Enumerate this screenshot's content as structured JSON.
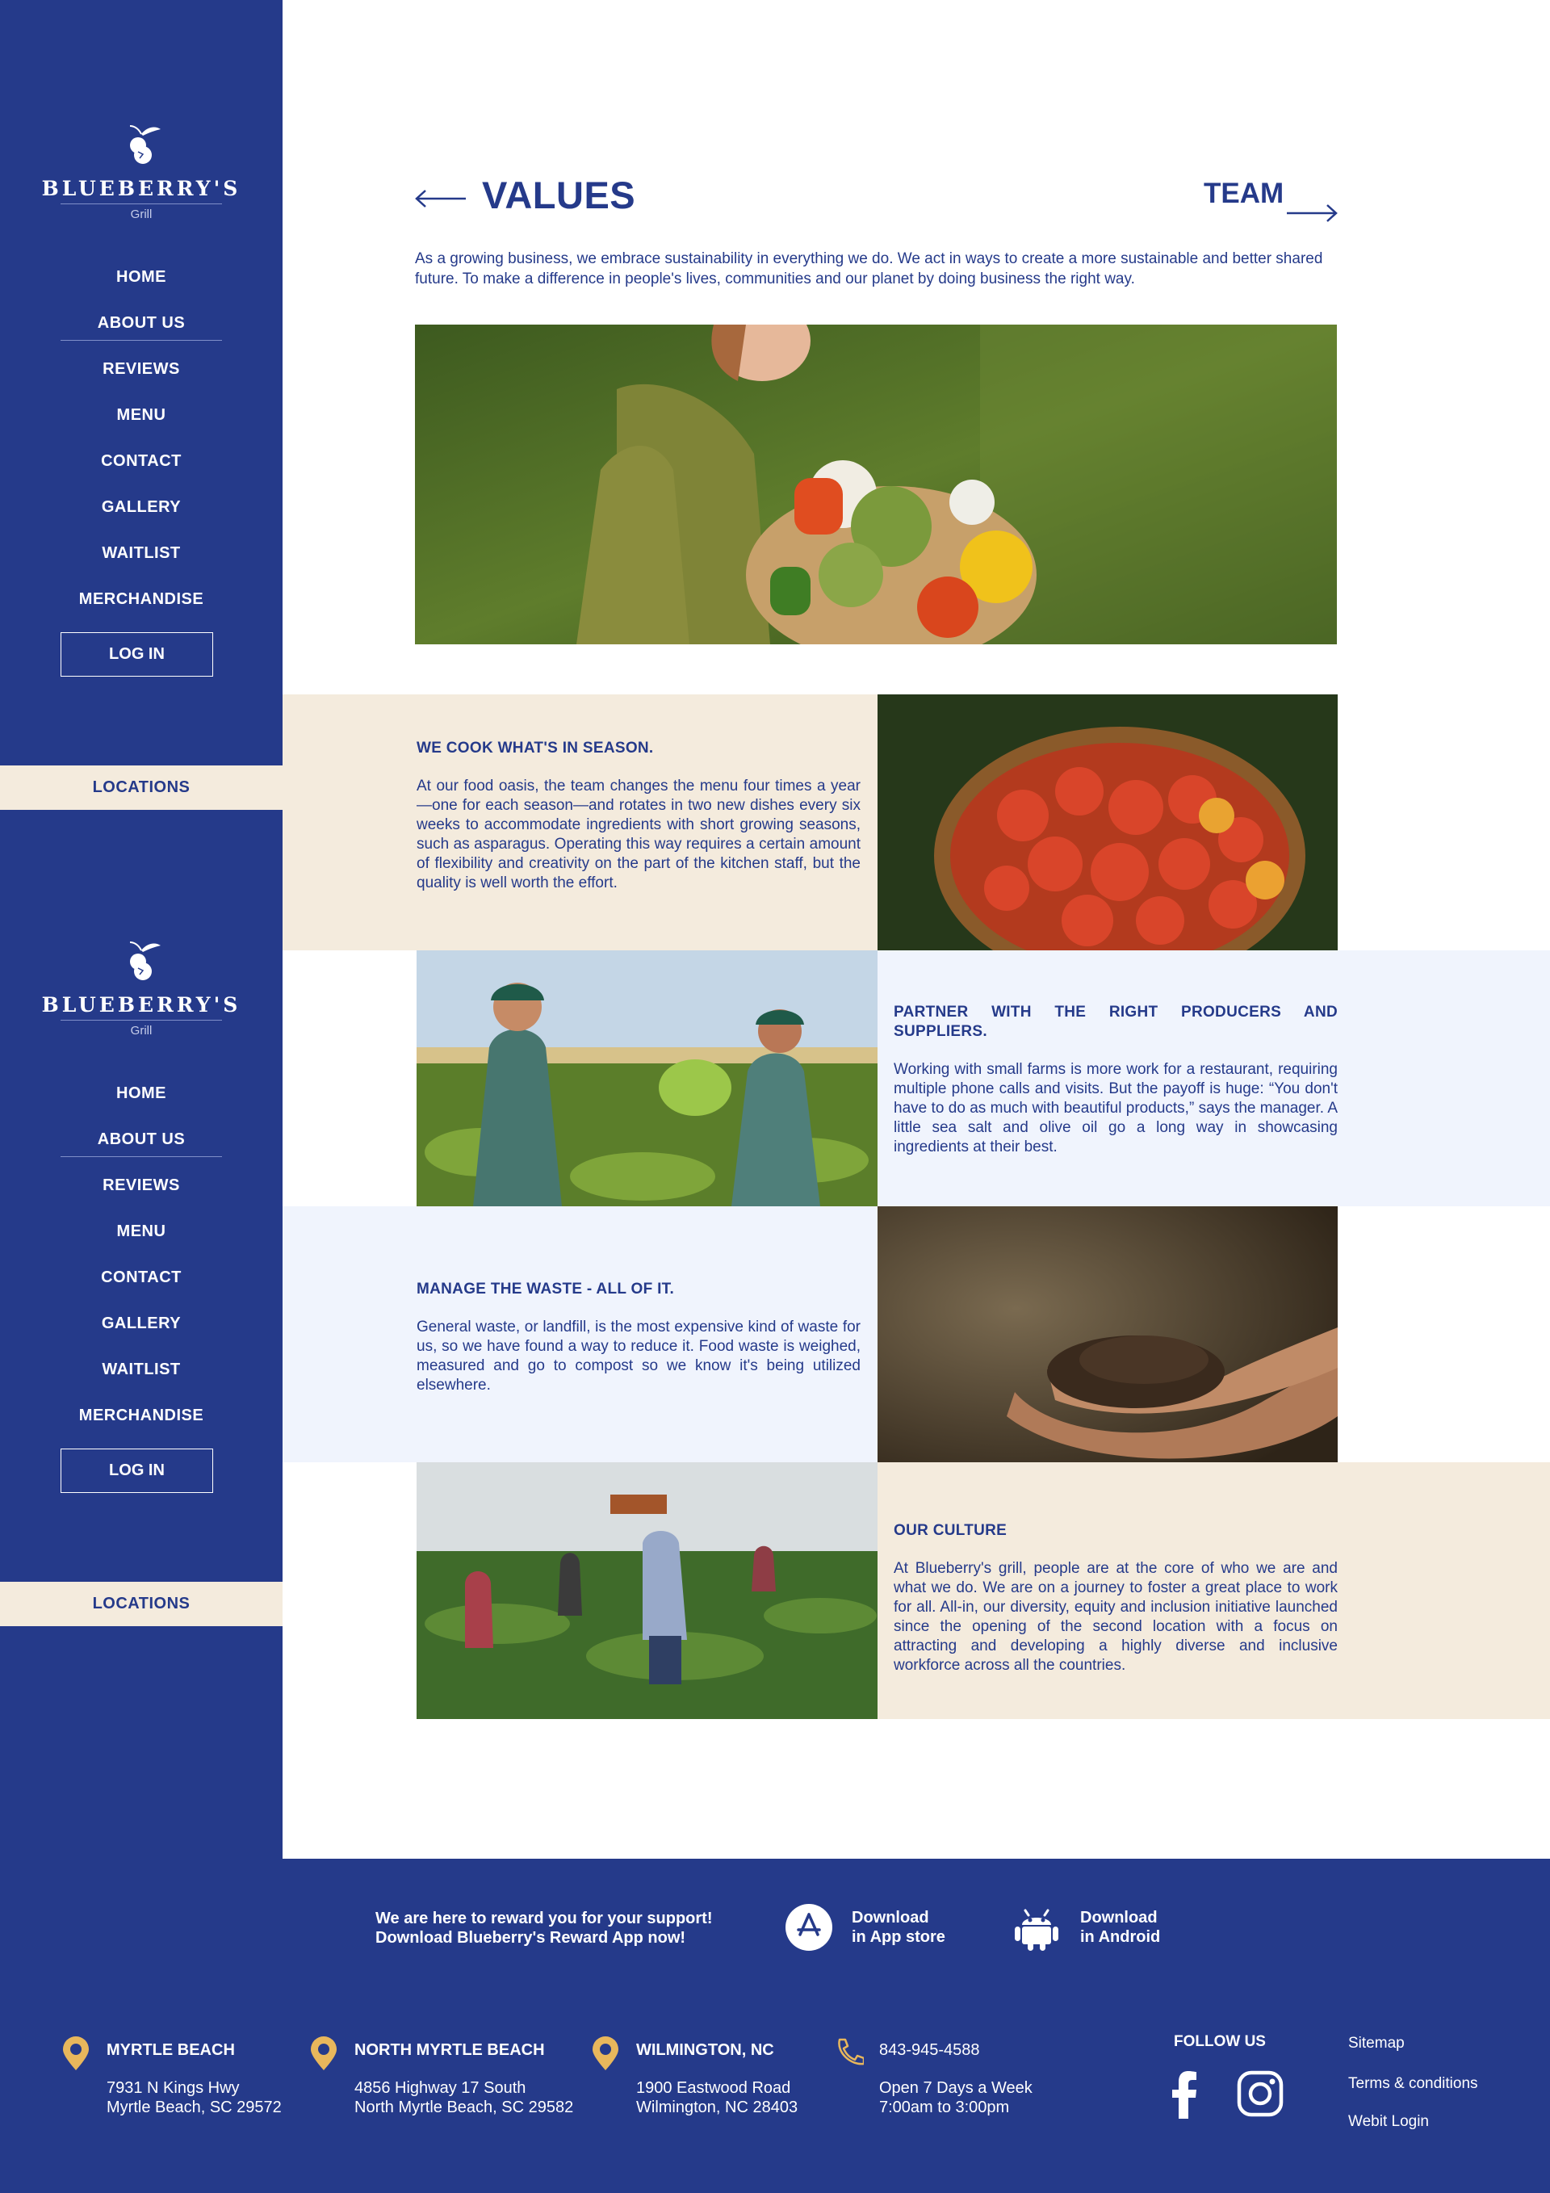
{
  "brand": {
    "name": "BLUEBERRY'S",
    "sub": "Grill"
  },
  "nav": {
    "items": [
      {
        "label": "HOME"
      },
      {
        "label": "ABOUT US"
      },
      {
        "label": "REVIEWS"
      },
      {
        "label": "MENU"
      },
      {
        "label": "CONTACT"
      },
      {
        "label": "GALLERY"
      },
      {
        "label": "WAITLIST"
      },
      {
        "label": "MERCHANDISE"
      }
    ],
    "login": "LOG IN",
    "locations": "LOCATIONS"
  },
  "page": {
    "title": "VALUES",
    "next_label": "TEAM",
    "intro": "As a growing business, we embrace sustainability in everything we do. We act in ways to create a more sustainable and better shared future. To make a difference in people's lives, communities and our planet by doing business the right way."
  },
  "rows": [
    {
      "heading": "WE COOK WHAT'S IN SEASON.",
      "body": "At our food oasis, the team changes the menu four times a year—one for each season—and rotates in two new dishes every six weeks to accommodate ingredients with short growing seasons, such as asparagus. Operating this way requires a certain amount of flexibility and creativity on the part of the kitchen staff, but the quality is well worth the effort."
    },
    {
      "heading": "PARTNER WITH THE RIGHT PRODUCERS AND SUPPLIERS.",
      "body": "Working with small farms is more work for a restaurant, requiring multiple phone calls and visits. But the payoff is huge: “You don't have to do as much with beautiful products,” says the manager. A little sea salt and olive oil go a long way in showcasing ingredients at their best."
    },
    {
      "heading": "MANAGE THE WASTE - ALL OF IT.",
      "body": "General waste, or landfill, is the most expensive kind of waste for us, so we have found a way to reduce it. Food waste is weighed, measured and go to compost so we know it's being utilized elsewhere."
    },
    {
      "heading": "OUR CULTURE",
      "body": "At Blueberry's grill, people are at the core of who we are and what we do. We are on a journey to foster a great place to work for all. All-in, our diversity, equity and inclusion initiative launched since the opening of the second location with a focus on attracting and developing a highly diverse and inclusive workforce across all the countries."
    }
  ],
  "footer": {
    "promo_line1": "We are here to reward you for your support!",
    "promo_line2": "Download Blueberry's Reward App now!",
    "appstore_line1": "Download",
    "appstore_line2": "in App store",
    "android_line1": "Download",
    "android_line2": "in Android",
    "locations": [
      {
        "title": "MYRTLE BEACH",
        "line1": "7931 N Kings Hwy",
        "line2": "Myrtle Beach, SC 29572"
      },
      {
        "title": "NORTH MYRTLE BEACH",
        "line1": "4856 Highway 17 South",
        "line2": "North Myrtle Beach, SC 29582"
      },
      {
        "title": "WILMINGTON, NC",
        "line1": "1900 Eastwood Road",
        "line2": "Wilmington, NC 28403"
      }
    ],
    "phone": "843-945-4588",
    "hours_line1": "Open 7 Days a Week",
    "hours_line2": "7:00am to 3:00pm",
    "follow": "FOLLOW US",
    "links": [
      "Sitemap",
      "Terms & conditions",
      "Webit Login"
    ]
  },
  "colors": {
    "navy": "#253a8a",
    "cream": "#f4ebdd",
    "pale_blue": "#f0f4fd",
    "gold": "#e8b75c"
  },
  "icons": [
    "back-arrow-icon",
    "forward-arrow-icon",
    "app-store-icon",
    "android-icon",
    "location-pin-icon",
    "phone-icon",
    "facebook-icon",
    "instagram-icon"
  ]
}
